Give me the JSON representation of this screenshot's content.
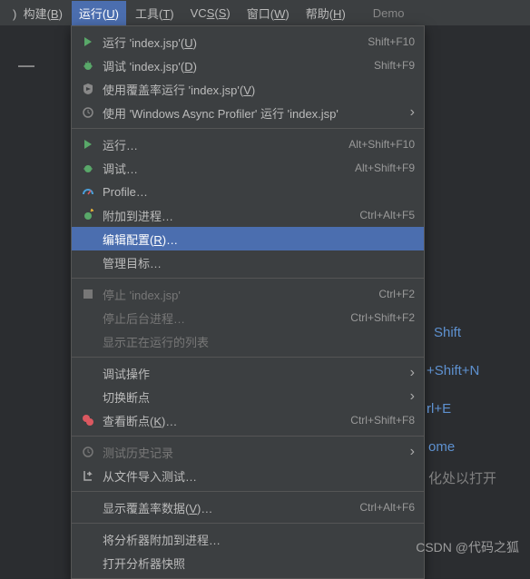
{
  "menubar": {
    "build_l": "构建(",
    "build_m": "B",
    "build_r": ")",
    "run_l": "运行(",
    "run_m": "U",
    "run_r": ")",
    "tools_l": "工具(",
    "tools_m": "T",
    "tools_r": ")",
    "vcs_l": "VC",
    "vcs_m": "S",
    "vcs_r": "(",
    "vcs_m2": "S",
    "vcs_r2": ")",
    "window_l": "窗口(",
    "window_m": "W",
    "window_r": ")",
    "help_l": "帮助(",
    "help_m": "H",
    "help_r": ")",
    "demo": "Demo"
  },
  "vcs_full": "VCS(S)",
  "items": {
    "run_index_l": "运行 'index.jsp'(",
    "run_index_m": "U",
    "run_index_r": ")",
    "run_index_sc": "Shift+F10",
    "debug_index_l": "调试 'index.jsp'(",
    "debug_index_m": "D",
    "debug_index_r": ")",
    "debug_index_sc": "Shift+F9",
    "coverage_l": "使用覆盖率运行  'index.jsp'(",
    "coverage_m": "V",
    "coverage_r": ")",
    "profiler": "使用 'Windows Async Profiler' 运行  'index.jsp'",
    "run_generic": "运行…",
    "run_generic_sc": "Alt+Shift+F10",
    "debug_generic": "调试…",
    "debug_generic_sc": "Alt+Shift+F9",
    "profile": "Profile…",
    "attach": "附加到进程…",
    "attach_sc": "Ctrl+Alt+F5",
    "edit_config_l": "编辑配置(",
    "edit_config_m": "R",
    "edit_config_r": ")…",
    "manage_targets": "管理目标…",
    "stop": "停止 'index.jsp'",
    "stop_sc": "Ctrl+F2",
    "stop_bg": "停止后台进程…",
    "stop_bg_sc": "Ctrl+Shift+F2",
    "show_running": "显示正在运行的列表",
    "debug_ops": "调试操作",
    "toggle_bp": "切换断点",
    "view_bp_l": "查看断点(",
    "view_bp_m": "K",
    "view_bp_r": ")…",
    "view_bp_sc": "Ctrl+Shift+F8",
    "test_history": "测试历史记录",
    "import_tests": "从文件导入测试…",
    "show_coverage_l": "显示覆盖率数据(",
    "show_coverage_m": "V",
    "show_coverage_r": ")…",
    "show_coverage_sc": "Ctrl+Alt+F6",
    "attach_profiler": "将分析器附加到进程…",
    "open_snapshot": "打开分析器快照"
  },
  "bg": {
    "shift": "Shift",
    "shiftn": "+Shift+N",
    "ctrle": "rl+E",
    "ome": "ome",
    "openhere": "化处以打开"
  },
  "watermark": "CSDN @代码之狐",
  "dash": "—"
}
